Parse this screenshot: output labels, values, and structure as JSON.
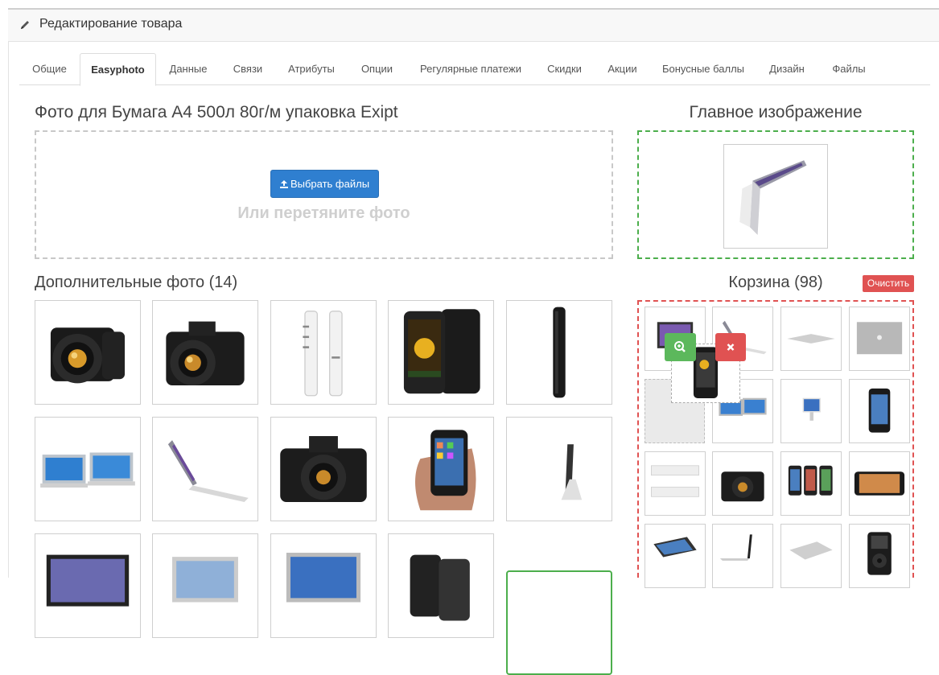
{
  "panel": {
    "title": "Редактирование товара",
    "icon": "pencil-icon"
  },
  "tabs": [
    {
      "label": "Общие"
    },
    {
      "label": "Easyphoto"
    },
    {
      "label": "Данные"
    },
    {
      "label": "Связи"
    },
    {
      "label": "Атрибуты"
    },
    {
      "label": "Опции"
    },
    {
      "label": "Регулярные платежи"
    },
    {
      "label": "Скидки"
    },
    {
      "label": "Акции"
    },
    {
      "label": "Бонусные баллы"
    },
    {
      "label": "Дизайн"
    },
    {
      "label": "Файлы"
    }
  ],
  "active_tab": "Easyphoto",
  "upload": {
    "title": "Фото для Бумага А4 500л 80г/м упаковка Exipt",
    "button_label": "Выбрать файлы",
    "button_icon": "upload-icon",
    "hint": "Или перетяните фото"
  },
  "main_image": {
    "title": "Главное изображение",
    "image": "laptop-open-icon"
  },
  "extra": {
    "title": "Дополнительные фото (14)",
    "images": [
      "camera-icon",
      "camera-icon",
      "phone-side-icon",
      "phone-icon",
      "phone-side-icon",
      "laptop-icon",
      "laptop-open-icon",
      "camera-icon",
      "phone-hand-icon",
      "monitor-icon",
      "laptop-icon",
      "monitor-icon",
      "laptop-icon",
      "phone-icon"
    ]
  },
  "trash": {
    "title": "Корзина (98)",
    "clear_label": "Очистить",
    "images": [
      "monitor-icon",
      "laptop-open-icon",
      "laptop-icon",
      "laptop-icon",
      "laptop-icon",
      "monitor-icon",
      "phone-icon",
      "laptop-icon",
      "camera-icon",
      "phone-icon",
      "phone-icon",
      "phone-side-icon",
      "laptop-open-icon",
      "laptop-icon",
      "ipod-icon"
    ],
    "dragging_image": "phone-icon"
  },
  "colors": {
    "primary": "#2f7fd0",
    "success": "#5cb85c",
    "danger": "#e05252",
    "dropzone_border": "#c8c8c8",
    "text": "#333333"
  }
}
